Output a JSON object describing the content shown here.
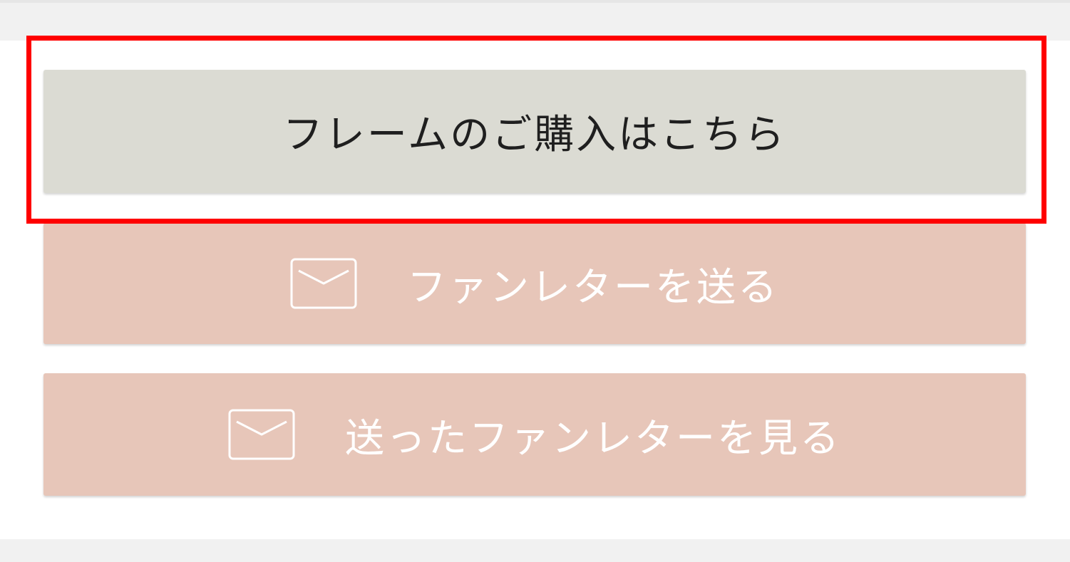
{
  "buttons": {
    "purchase_label": "フレームのご購入はこちら",
    "send_fanletter_label": "ファンレターを送る",
    "view_sent_fanletters_label": "送ったファンレターを見る"
  },
  "icons": {
    "send_fanletter": "envelope-icon",
    "view_sent_fanletters": "envelope-icon"
  },
  "colors": {
    "purchase_button_bg": "#dbdbd3",
    "fanletter_button_bg": "#e7c6b9",
    "highlight_border": "#ff0000",
    "page_bg": "#f1f1f1",
    "panel_bg": "#ffffff"
  }
}
